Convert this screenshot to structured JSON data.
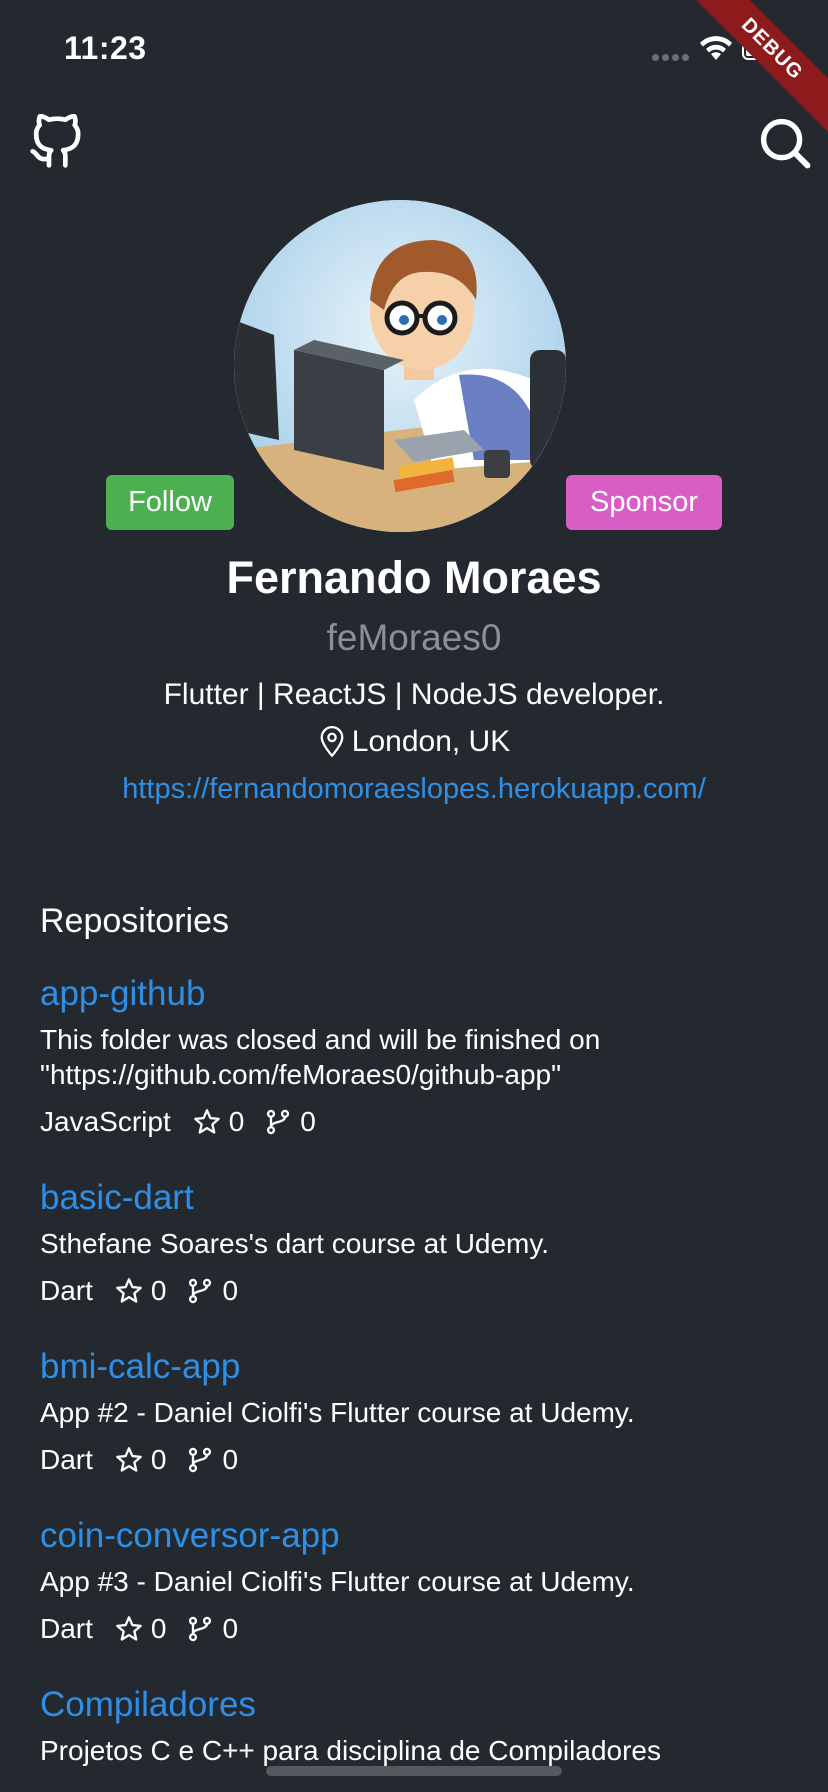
{
  "status_bar": {
    "time": "11:23",
    "debug_label": "DEBUG"
  },
  "app_bar": {
    "logo_icon": "github-octocat-icon",
    "search_icon": "search-icon"
  },
  "profile": {
    "avatar_icon": "avatar-cartoon-developer",
    "follow_label": "Follow",
    "sponsor_label": "Sponsor",
    "name": "Fernando Moraes",
    "login": "feMoraes0",
    "bio": "Flutter | ReactJS | NodeJS developer.",
    "location": "London, UK",
    "website": "https://fernandomoraeslopes.herokuapp.com/"
  },
  "repositories": {
    "heading": "Repositories",
    "items": [
      {
        "name": "app-github",
        "description": "This folder was closed and will be finished on\n\"https://github.com/feMoraes0/github-app\"",
        "language": "JavaScript",
        "stars": "0",
        "forks": "0"
      },
      {
        "name": "basic-dart",
        "description": "Sthefane Soares's dart course at Udemy.",
        "language": "Dart",
        "stars": "0",
        "forks": "0"
      },
      {
        "name": "bmi-calc-app",
        "description": "App #2 - Daniel Ciolfi's Flutter course at Udemy.",
        "language": "Dart",
        "stars": "0",
        "forks": "0"
      },
      {
        "name": "coin-conversor-app",
        "description": "App #3 - Daniel Ciolfi's Flutter course at Udemy.",
        "language": "Dart",
        "stars": "0",
        "forks": "0"
      },
      {
        "name": "Compiladores",
        "description": "Projetos C e C++ para disciplina de Compiladores",
        "language": "",
        "stars": "",
        "forks": ""
      }
    ]
  },
  "colors": {
    "background": "#24292f",
    "link": "#2f8fe6",
    "follow": "#4caf50",
    "sponsor": "#d65ec4",
    "muted": "#8b9096"
  }
}
